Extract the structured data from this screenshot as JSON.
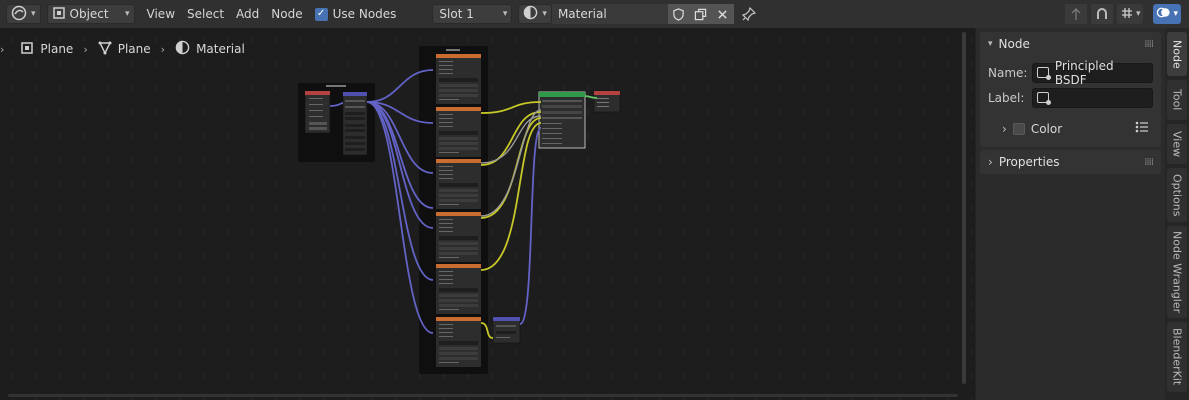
{
  "header": {
    "editor_type_icon": "node-editor-icon",
    "mode": "Object",
    "menus": [
      "View",
      "Select",
      "Add",
      "Node"
    ],
    "use_nodes_label": "Use Nodes",
    "use_nodes_checked": true,
    "slot": "Slot 1",
    "material_name": "Material"
  },
  "breadcrumb": {
    "items": [
      "Plane",
      "Plane",
      "Material"
    ]
  },
  "sidebar": {
    "node_panel_title": "Node",
    "name_label": "Name:",
    "name_value": "Principled BSDF",
    "label_label": "Label:",
    "label_value": "",
    "color_label": "Color",
    "properties_title": "Properties"
  },
  "tabs": [
    "Node",
    "Tool",
    "View",
    "Options",
    "Node Wrangler",
    "BlenderKit"
  ],
  "colors": {
    "accent": "#4772b3",
    "link_vector": "#6363c7",
    "link_color": "#c7c729",
    "link_shader": "#63c763",
    "header_texture": "#c96c2f",
    "header_output": "#b4423e",
    "header_shader": "#2e9a4a",
    "header_vector": "#5050b0"
  }
}
